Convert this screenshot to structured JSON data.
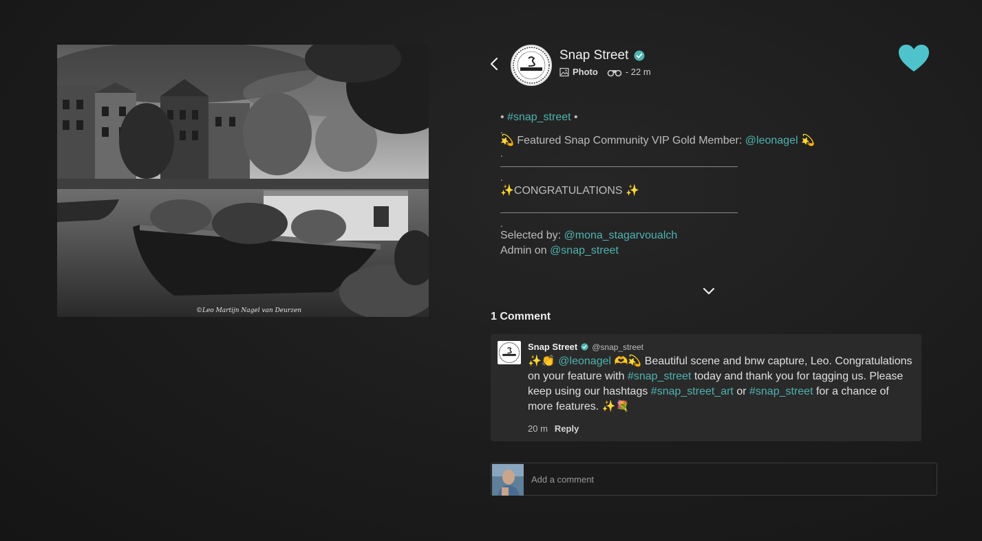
{
  "post": {
    "author": "Snap Street",
    "type_label": "Photo",
    "time": "- 22 m",
    "photo_credit": "©Leo Martijn Nagel van Deurzen"
  },
  "caption": {
    "line1_pre": "• ",
    "line1_tag": "#snap_street",
    "line1_post": " •",
    "dot": ".",
    "featured_pre": "💫 Featured Snap Community VIP Gold Member: ",
    "featured_user": "@leonagel",
    "featured_post": " 💫",
    "congrats": "✨CONGRATULATIONS ✨",
    "selected_pre": "Selected by: ",
    "selected_user": "@mona_stagarvoualch",
    "admin_pre": "Admin on ",
    "admin_user": "@snap_street"
  },
  "comments": {
    "count_label": "1 Comment",
    "items": [
      {
        "name": "Snap Street",
        "handle": "@snap_street",
        "t1": "✨👏 ",
        "u1": "@leonagel",
        "t2": " 🫶💫 Beautiful scene and bnw capture, Leo. Congratulations on your feature with ",
        "h1": "#snap_street",
        "t3": " today and thank you for tagging us. Please keep using our hashtags ",
        "h2": "#snap_street_art",
        "t4": " or ",
        "h3": "#snap_street",
        "t5": " for a chance of more features. ✨💐",
        "time": "20 m",
        "reply": "Reply"
      }
    ]
  },
  "add_comment": {
    "placeholder": "Add a comment"
  },
  "colors": {
    "accent": "#4fb3b0",
    "heart": "#4fc3cc",
    "background": "#1c1c1c"
  }
}
